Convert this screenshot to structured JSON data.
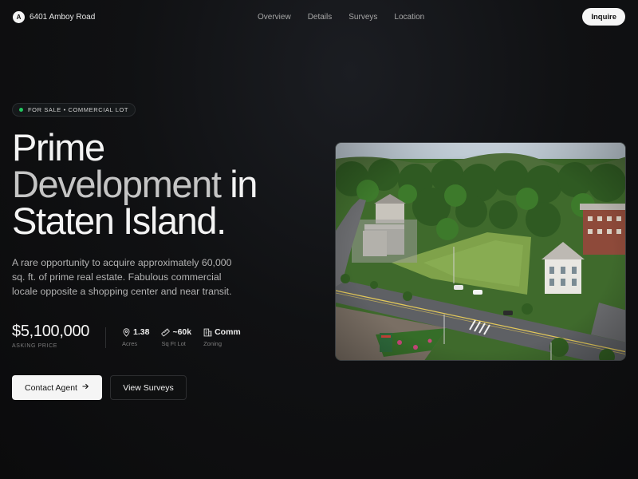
{
  "nav": {
    "logo_letter": "A",
    "brand": "6401 Amboy Road",
    "links": [
      "Overview",
      "Details",
      "Surveys",
      "Location"
    ],
    "cta": "Inquire"
  },
  "hero": {
    "badge": "FOR SALE • COMMERCIAL LOT",
    "badge_color": "#22c55e",
    "headline_line1": "Prime",
    "headline_line2_muted": "Development",
    "headline_line2_rest": " in",
    "headline_line3": "Staten Island.",
    "description": "A rare opportunity to acquire approximately 60,000 sq. ft. of prime real estate. Fabulous commercial locale opposite a shopping center and near transit.",
    "price": "$5,100,000",
    "price_label": "ASKING PRICE",
    "stats": [
      {
        "icon": "map-pin-icon",
        "value": "1.38",
        "label": "Acres"
      },
      {
        "icon": "ruler-icon",
        "value": "~60k",
        "label": "Sq Ft Lot"
      },
      {
        "icon": "building-icon",
        "value": "Comm",
        "label": "Zoning"
      }
    ],
    "primary_button": "Contact Agent",
    "primary_button_icon": "arrow-right-icon",
    "secondary_button": "View Surveys"
  },
  "photo": {
    "subject": "aerial-view-of-lot-icon"
  }
}
